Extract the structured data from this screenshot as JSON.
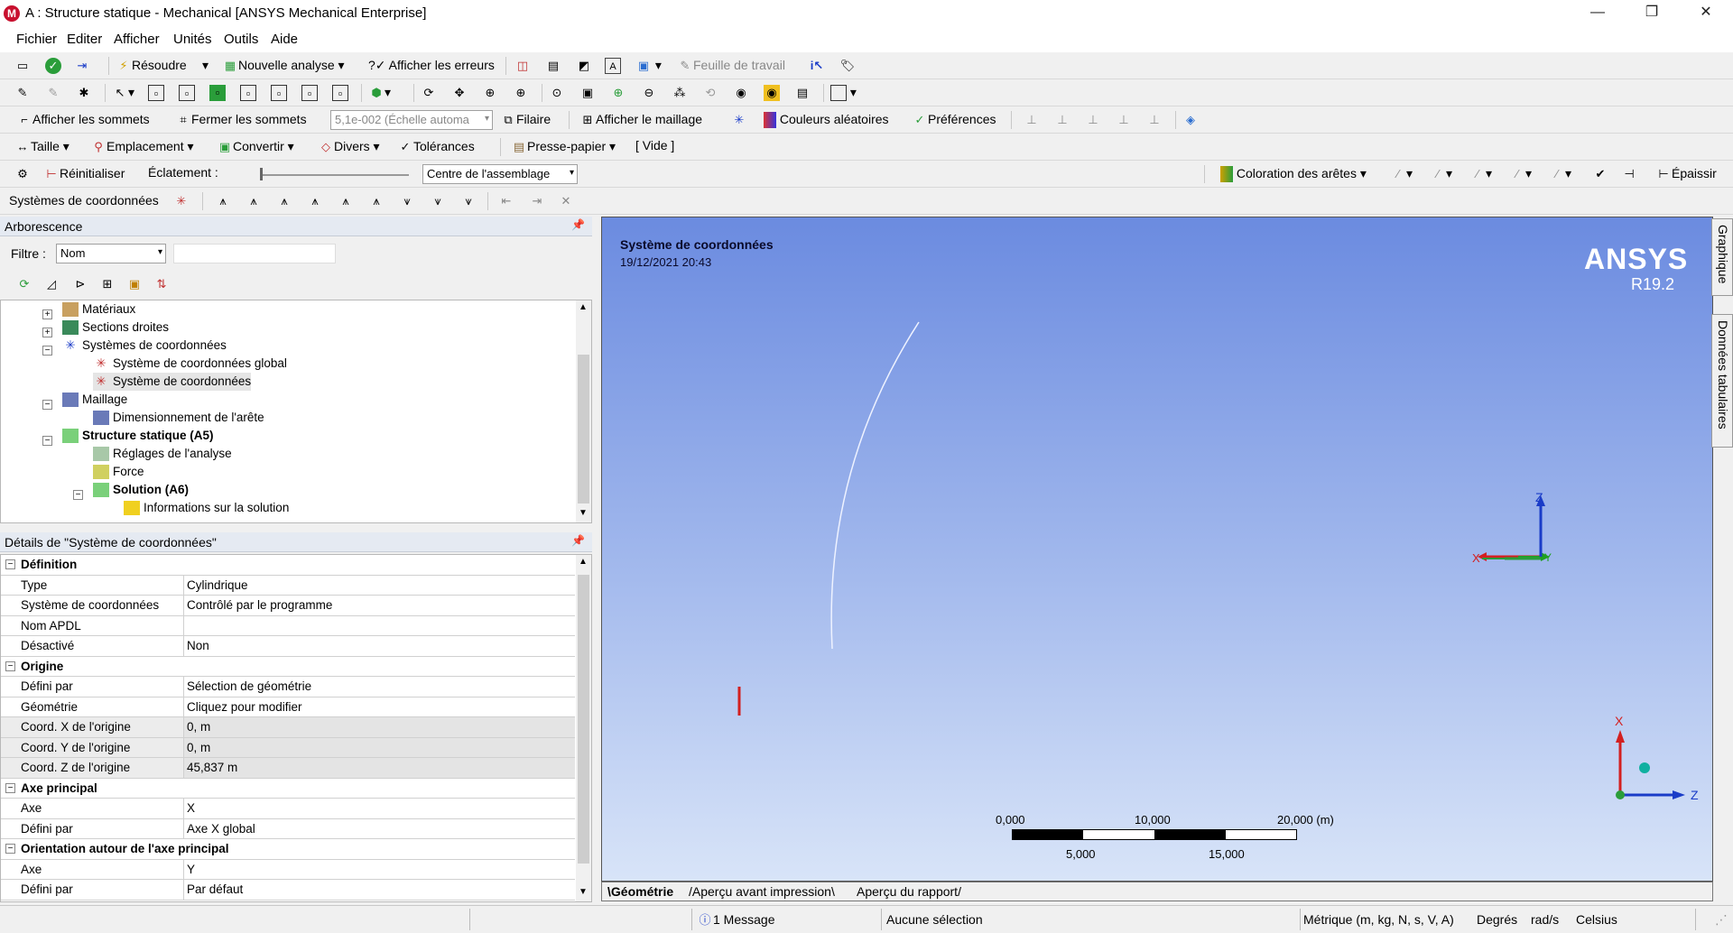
{
  "window": {
    "title": "A : Structure statique - Mechanical [ANSYS Mechanical Enterprise]"
  },
  "menu": [
    "Fichier",
    "Editer",
    "Afficher",
    "Unités",
    "Outils",
    "Aide"
  ],
  "toolbar1": {
    "solve": "Résoudre",
    "new_analysis": "Nouvelle analyse",
    "show_errors": "?✓ Afficher les erreurs",
    "worksheet": "Feuille de travail"
  },
  "toolbar3": {
    "show_vertices": "Afficher les sommets",
    "close_vertices": "Fermer les sommets",
    "scale": "5,1e-002 (Échelle automa",
    "wireframe": "Filaire",
    "show_mesh": "Afficher le maillage",
    "random_colors": "Couleurs aléatoires",
    "preferences": "Préférences"
  },
  "toolbar4": {
    "size": "Taille",
    "location": "Emplacement",
    "convert": "Convertir",
    "misc": "Divers",
    "tolerances": "Tolérances",
    "clipboard": "Presse-papier",
    "empty": "[ Vide ]"
  },
  "toolbar5": {
    "reset": "Réinitialiser",
    "explode": "Éclatement :",
    "center": "Centre de l'assemblage",
    "edge_coloring": "Coloration des arêtes",
    "thicken": "Épaissir"
  },
  "toolbar6": {
    "label": "Systèmes de coordonnées"
  },
  "tree": {
    "header": "Arborescence",
    "filter_label": "Filtre :",
    "filter_value": "Nom",
    "nodes": [
      {
        "label": "Matériaux"
      },
      {
        "label": "Sections droites"
      },
      {
        "label": "Systèmes de coordonnées"
      },
      {
        "label": "Système de coordonnées global"
      },
      {
        "label": "Système de coordonnées"
      },
      {
        "label": "Maillage"
      },
      {
        "label": "Dimensionnement de l'arête"
      },
      {
        "label": "Structure statique (A5)"
      },
      {
        "label": "Réglages de l'analyse"
      },
      {
        "label": "Force"
      },
      {
        "label": "Solution (A6)"
      },
      {
        "label": "Informations sur la solution"
      }
    ]
  },
  "details": {
    "header": "Détails de \"Système de coordonnées\"",
    "rows": [
      {
        "k": "Définition",
        "v": ""
      },
      {
        "k": "Type",
        "v": "Cylindrique"
      },
      {
        "k": "Système de coordonnées",
        "v": "Contrôlé par le programme"
      },
      {
        "k": "Nom APDL",
        "v": ""
      },
      {
        "k": "Désactivé",
        "v": "Non"
      },
      {
        "k": "Origine",
        "v": ""
      },
      {
        "k": "Défini par",
        "v": "Sélection de géométrie"
      },
      {
        "k": "Géométrie",
        "v": "Cliquez pour modifier"
      },
      {
        "k": "Coord. X de l'origine",
        "v": "0, m"
      },
      {
        "k": "Coord. Y de l'origine",
        "v": "0, m"
      },
      {
        "k": "Coord. Z de l'origine",
        "v": "45,837 m"
      },
      {
        "k": "Axe principal",
        "v": ""
      },
      {
        "k": "Axe",
        "v": "X"
      },
      {
        "k": "Défini par",
        "v": "Axe X global"
      },
      {
        "k": "Orientation autour de l'axe principal",
        "v": ""
      },
      {
        "k": "Axe",
        "v": "Y"
      },
      {
        "k": "Défini par",
        "v": "Par défaut"
      }
    ]
  },
  "viewport": {
    "title": "Système de coordonnées",
    "date": "19/12/2021 20:43",
    "brand": "ANSYS",
    "version": "R19.2",
    "scale_top": [
      "0,000",
      "10,000",
      "20,000 (m)"
    ],
    "scale_bottom": [
      "5,000",
      "15,000"
    ],
    "axis_labels": {
      "x": "X",
      "y": "Y",
      "z": "Z"
    }
  },
  "bottom_tabs": [
    "Géométrie",
    "Aperçu avant impression",
    "Aperçu du rapport"
  ],
  "side_tabs": [
    "Graphique",
    "Données tabulaires"
  ],
  "status": {
    "messages": "1 Message",
    "selection": "Aucune sélection",
    "units": "Métrique (m, kg, N, s, V, A)",
    "degrees": "Degrés",
    "rads": "rad/s",
    "temp": "Celsius"
  },
  "colors": {
    "viewport_top": "#6b8be0",
    "viewport_bottom": "#d8e4f8",
    "axis_x": "#d32020",
    "axis_y": "#20a020",
    "axis_z": "#1a3cc8"
  }
}
